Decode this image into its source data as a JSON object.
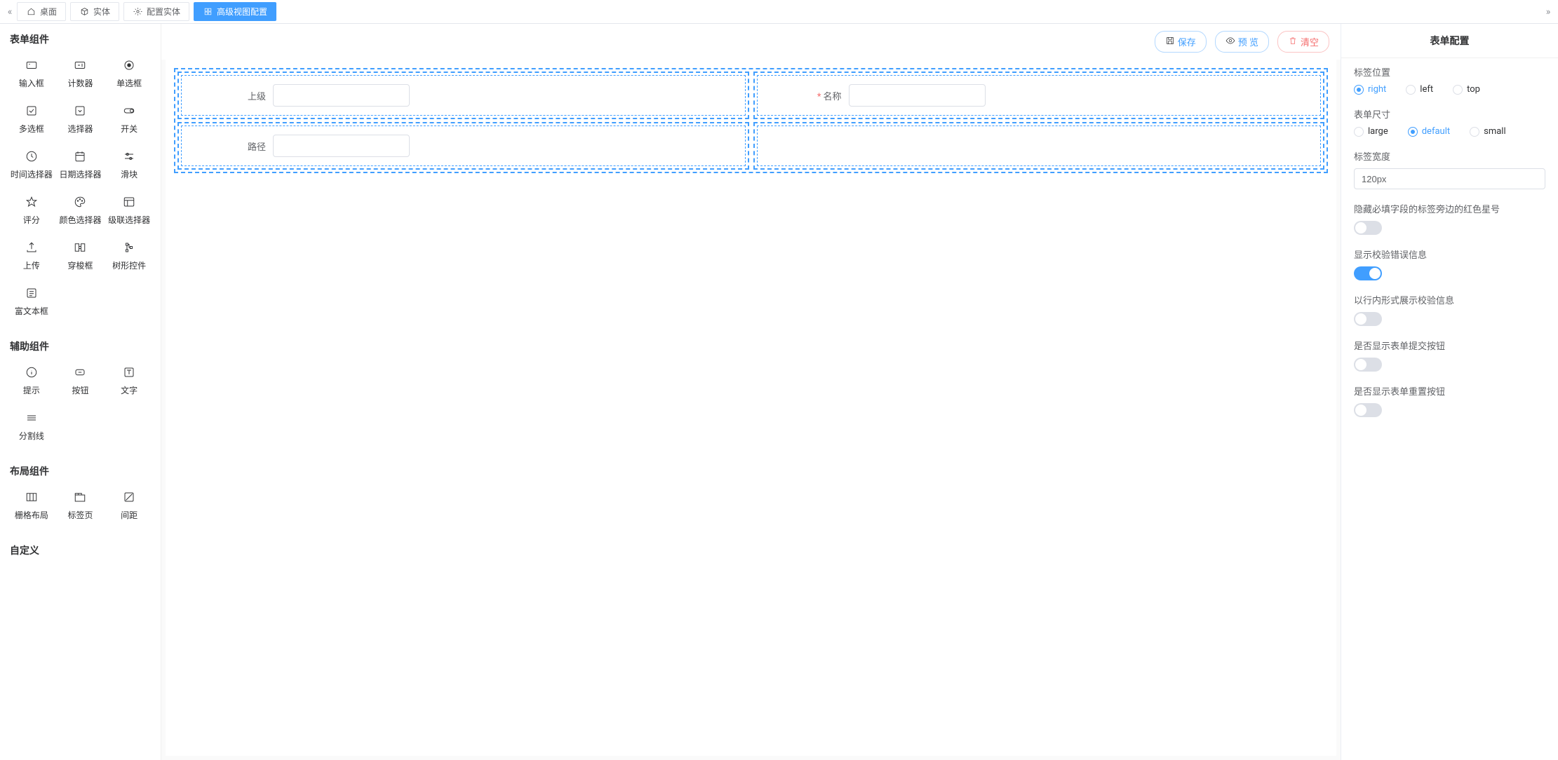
{
  "tabs": {
    "left_arrow": "«",
    "right_arrow": "»",
    "items": [
      {
        "label": "桌面",
        "icon": "home"
      },
      {
        "label": "实体",
        "icon": "cube"
      },
      {
        "label": "配置实体",
        "icon": "gear"
      },
      {
        "label": "高级视图配置",
        "icon": "grid",
        "active": true
      }
    ]
  },
  "palette": {
    "sections": [
      {
        "title": "表单组件",
        "items": [
          {
            "label": "输入框",
            "icon": "input"
          },
          {
            "label": "计数器",
            "icon": "counter"
          },
          {
            "label": "单选框",
            "icon": "radio"
          },
          {
            "label": "多选框",
            "icon": "checkbox"
          },
          {
            "label": "选择器",
            "icon": "select"
          },
          {
            "label": "开关",
            "icon": "switch"
          },
          {
            "label": "时间选择器",
            "icon": "clock"
          },
          {
            "label": "日期选择器",
            "icon": "calendar"
          },
          {
            "label": "滑块",
            "icon": "slider"
          },
          {
            "label": "评分",
            "icon": "star"
          },
          {
            "label": "颜色选择器",
            "icon": "palette"
          },
          {
            "label": "级联选择器",
            "icon": "cascade"
          },
          {
            "label": "上传",
            "icon": "upload"
          },
          {
            "label": "穿梭框",
            "icon": "transfer"
          },
          {
            "label": "树形控件",
            "icon": "tree"
          },
          {
            "label": "富文本框",
            "icon": "richtext"
          }
        ]
      },
      {
        "title": "辅助组件",
        "items": [
          {
            "label": "提示",
            "icon": "info"
          },
          {
            "label": "按钮",
            "icon": "button"
          },
          {
            "label": "文字",
            "icon": "text"
          },
          {
            "label": "分割线",
            "icon": "divider"
          }
        ]
      },
      {
        "title": "布局组件",
        "items": [
          {
            "label": "栅格布局",
            "icon": "cols"
          },
          {
            "label": "标签页",
            "icon": "tabs"
          },
          {
            "label": "间距",
            "icon": "slash"
          }
        ]
      },
      {
        "title": "自定义",
        "items": []
      }
    ]
  },
  "toolbar": {
    "save": "保存",
    "preview": "预 览",
    "clear": "清空"
  },
  "canvas": {
    "fields": {
      "parent": {
        "label": "上级",
        "required": false
      },
      "name": {
        "label": "名称",
        "required": true
      },
      "path": {
        "label": "路径",
        "required": false
      }
    }
  },
  "config": {
    "title": "表单配置",
    "labelPosition": {
      "label": "标签位置",
      "options": [
        "right",
        "left",
        "top"
      ],
      "value": "right"
    },
    "formSize": {
      "label": "表单尺寸",
      "options": [
        "large",
        "default",
        "small"
      ],
      "value": "default"
    },
    "labelWidth": {
      "label": "标签宽度",
      "value": "120px"
    },
    "hideAsterisk": {
      "label": "隐藏必填字段的标签旁边的红色星号",
      "value": false
    },
    "showMessage": {
      "label": "显示校验错误信息",
      "value": true
    },
    "inlineMessage": {
      "label": "以行内形式展示校验信息",
      "value": false
    },
    "showSubmit": {
      "label": "是否显示表单提交按钮",
      "value": false
    },
    "showReset": {
      "label": "是否显示表单重置按钮",
      "value": false
    }
  }
}
